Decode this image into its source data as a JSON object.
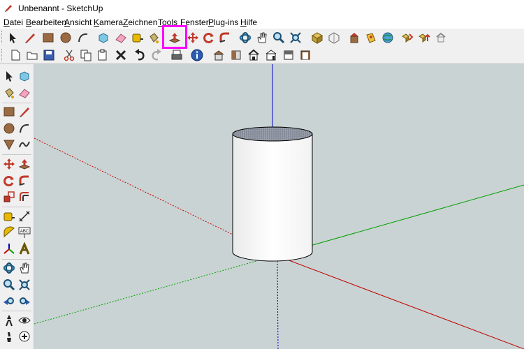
{
  "window": {
    "title": "Unbenannt - SketchUp"
  },
  "menu": [
    {
      "prefix": "",
      "u": "D",
      "rest": "atei"
    },
    {
      "prefix": "",
      "u": "B",
      "rest": "earbeiten"
    },
    {
      "prefix": "",
      "u": "A",
      "rest": "nsicht"
    },
    {
      "prefix": "",
      "u": "K",
      "rest": "amera"
    },
    {
      "prefix": "",
      "u": "Z",
      "rest": "eichnen"
    },
    {
      "prefix": "",
      "u": "T",
      "rest": "ools"
    },
    {
      "prefix": "",
      "u": "F",
      "rest": "enster"
    },
    {
      "prefix": "",
      "u": "P",
      "rest": "lug-ins"
    },
    {
      "prefix": "",
      "u": "H",
      "rest": "ilfe"
    }
  ],
  "toolbar_main": [
    "select-tool",
    "pencil-line-tool",
    "rectangle-tool",
    "circle-tool",
    "arc-tool",
    "make-component-tool",
    "eraser-tool",
    "tape-measure-tool",
    "paint-bucket-tool",
    "push-pull-tool",
    "move-tool",
    "rotate-tool",
    "follow-me-tool",
    "orbit-tool",
    "pan-tool",
    "zoom-tool",
    "zoom-extents-tool",
    "previous-view-tool",
    "next-view-tool",
    "get-models-tool",
    "share-model-tool",
    "share-component-tool",
    "get-photo-texture-tool",
    "extension-warehouse-tool",
    "warehouse-extra-tool"
  ],
  "toolbar_standard": [
    "new-file",
    "open-file",
    "save-file",
    "cut",
    "copy",
    "paste",
    "delete",
    "undo",
    "redo",
    "print",
    "model-info",
    "iso-view",
    "top-view",
    "front-view",
    "right-view",
    "back-view",
    "left-view"
  ],
  "highlighted_tool": "push-pull-tool",
  "sidebar_tools": [
    "select-tool",
    "make-component-tool",
    "paint-bucket-tool",
    "eraser-tool",
    "rectangle-tool",
    "line-tool",
    "circle-tool",
    "arc-tool",
    "polygon-tool",
    "freehand-tool",
    "move-tool",
    "push-pull-tool",
    "rotate-tool",
    "follow-me-tool",
    "scale-tool",
    "offset-tool",
    "tape-measure-tool",
    "dimension-tool",
    "protractor-tool",
    "text-tool",
    "axes-tool",
    "3d-text-tool",
    "orbit-tool",
    "pan-tool",
    "zoom-tool",
    "zoom-window-tool",
    "zoom-extents-tool",
    "previous-view-tool",
    "position-camera-tool",
    "look-around-tool",
    "walk-tool",
    "section-plane-tool"
  ],
  "sidebar_labels": {
    "text_tool": "ABC"
  },
  "colors": {
    "viewport_bg": "#c9d3d3",
    "highlight": "#ff00ff",
    "axis_red": "#c00000",
    "axis_green": "#00a000",
    "axis_blue": "#0000c8"
  },
  "scene": {
    "object": "cylinder"
  }
}
